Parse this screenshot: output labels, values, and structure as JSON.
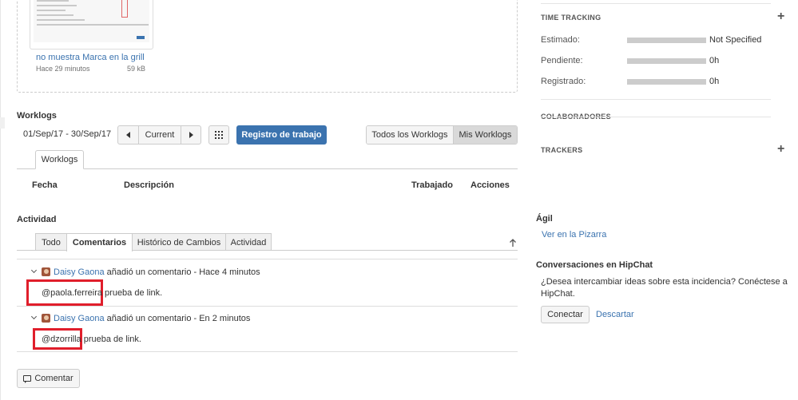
{
  "attachment": {
    "name": "no muestra Marca en la grill",
    "time": "Hace 29 minutos",
    "size": "59 kB"
  },
  "worklogs": {
    "title": "Worklogs",
    "date_range": "01/Sep/17 - 30/Sep/17",
    "current_label": "Current",
    "log_work_label": "Registro de trabajo",
    "filter_all": "Todos los Worklogs",
    "filter_mine": "Mis Worklogs",
    "tab": "Worklogs",
    "columns": [
      "Fecha",
      "Descripción",
      "Trabajado",
      "Acciones"
    ]
  },
  "activity": {
    "title": "Actividad",
    "tabs": [
      "Todo",
      "Comentarios",
      "Histórico de Cambios",
      "Actividad"
    ],
    "active_tab": "Comentarios",
    "comments": [
      {
        "author": "Daisy Gaona",
        "action": " añadió un comentario - Hace 4 minutos",
        "mention": "@paola.ferreira",
        "text": " prueba de link."
      },
      {
        "author": "Daisy Gaona",
        "action": " añadió un comentario - En 2 minutos",
        "mention": "@dzorrilla",
        "text": " prueba de link."
      }
    ],
    "comment_button": "Comentar"
  },
  "time_tracking": {
    "title": "TIME TRACKING",
    "rows": [
      {
        "label": "Estimado:",
        "value": "Not Specified"
      },
      {
        "label": "Pendiente:",
        "value": "0h"
      },
      {
        "label": "Registrado:",
        "value": "0h"
      }
    ]
  },
  "collaborators": {
    "title": "COLABORADORES"
  },
  "trackers": {
    "title": "TRACKERS"
  },
  "agile": {
    "title": "Ágil",
    "link": "Ver en la Pizarra"
  },
  "hipchat": {
    "title": "Conversaciones en HipChat",
    "text": "¿Desea intercambiar ideas sobre esta incidencia? Conéctese a HipChat.",
    "connect": "Conectar",
    "dismiss": "Descartar"
  },
  "colors": {
    "link": "#3b73af",
    "primary": "#3b73af",
    "highlight": "#e01e2b"
  }
}
